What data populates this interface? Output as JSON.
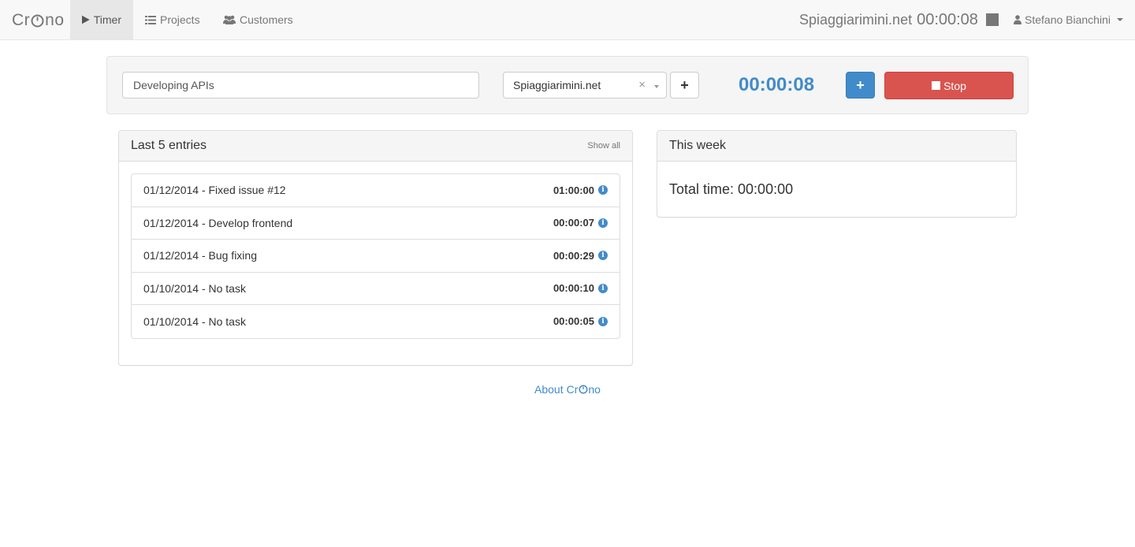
{
  "navbar": {
    "brand_prefix": "Cr",
    "brand_suffix": "no",
    "items": [
      {
        "label": "Timer",
        "icon": "play-icon",
        "active": true
      },
      {
        "label": "Projects",
        "icon": "list-icon",
        "active": false
      },
      {
        "label": "Customers",
        "icon": "users-icon",
        "active": false
      }
    ],
    "current_customer": "Spiaggiarimini.net",
    "current_time": "00:00:08",
    "user_name": "Stefano Bianchini"
  },
  "timer_form": {
    "task_value": "Developing APIs",
    "customer_selected": "Spiaggiarimini.net",
    "clear_symbol": "×",
    "add_customer_label": "+",
    "elapsed": "00:00:08",
    "plus_label": "+",
    "stop_label": "Stop"
  },
  "entries_panel": {
    "title": "Last 5 entries",
    "show_all": "Show all",
    "entries": [
      {
        "label": "01/12/2014 - Fixed issue #12",
        "duration": "01:00:00"
      },
      {
        "label": "01/12/2014 - Develop frontend",
        "duration": "00:00:07"
      },
      {
        "label": "01/12/2014 - Bug fixing",
        "duration": "00:00:29"
      },
      {
        "label": "01/10/2014 - No task",
        "duration": "00:00:10"
      },
      {
        "label": "01/10/2014 - No task",
        "duration": "00:00:05"
      }
    ]
  },
  "week_panel": {
    "title": "This week",
    "total": "Total time: 00:00:00"
  },
  "footer": {
    "about_label": "About",
    "brand_prefix": "Cr",
    "brand_suffix": "no"
  },
  "colors": {
    "primary": "#428bca",
    "danger": "#d9534f",
    "navbar_bg": "#f8f8f8"
  }
}
